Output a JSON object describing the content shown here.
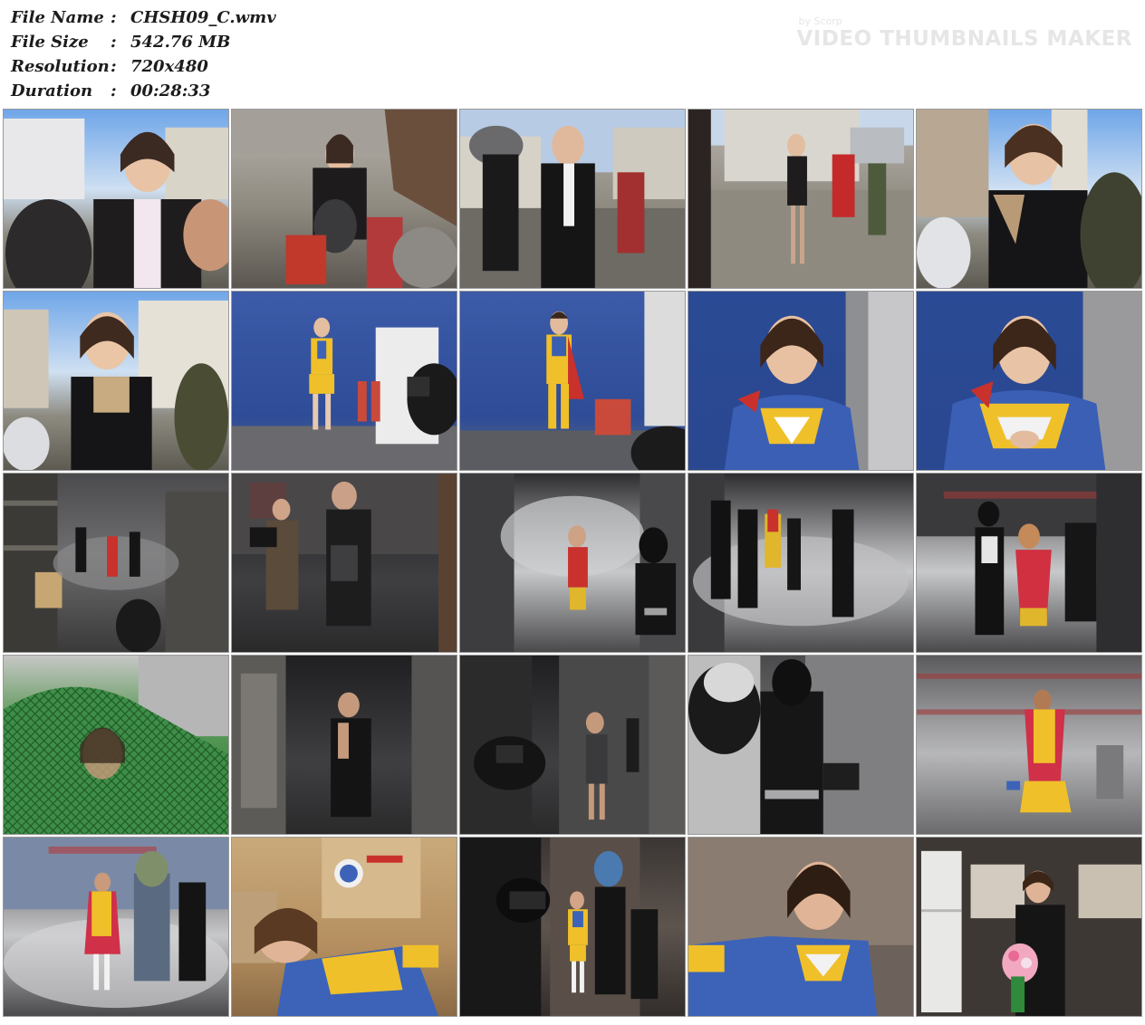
{
  "file_info": [
    {
      "label": "File Name",
      "value": "CHSH09_C.wmv"
    },
    {
      "label": "File Size",
      "value": "542.76 MB"
    },
    {
      "label": "Resolution",
      "value": "720x480"
    },
    {
      "label": "Duration",
      "value": "00:28:33"
    }
  ],
  "separator": ":",
  "brand": {
    "by": "by Scorp",
    "name": "VIDEO THUMBNAILS MAKER"
  }
}
